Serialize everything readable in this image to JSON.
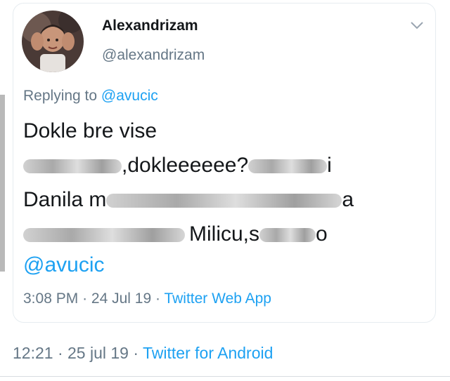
{
  "tweet": {
    "author": {
      "display_name": "Alexandrizam",
      "handle": "@alexandrizam"
    },
    "replying_prefix": "Replying to",
    "replying_handle": "@avucic",
    "lines": {
      "l1": "Dokle bre vise",
      "l2_text": ",dokleeeeee?",
      "l2_tail": "i",
      "l3_text": "Danila m",
      "l3_tail": "a",
      "l4_text": "Milicu,s",
      "l4_tail": "o"
    },
    "mention": "@avucic",
    "meta": {
      "time": "3:08 PM",
      "date": "24 Jul 19",
      "source": "Twitter Web App"
    }
  },
  "outer": {
    "time": "12:21",
    "date": "25 jul 19",
    "source": "Twitter for Android"
  },
  "colors": {
    "link": "#1da1f2",
    "muted": "#657786",
    "text": "#14171a"
  },
  "icons": {
    "menu": "chevron-down-icon"
  }
}
